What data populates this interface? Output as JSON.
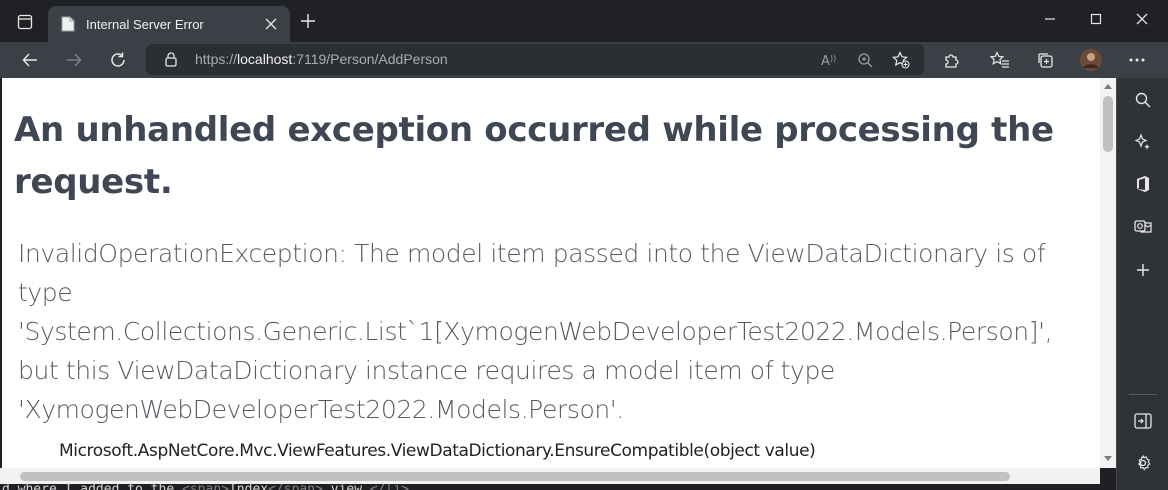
{
  "browser": {
    "tab_title": "Internal Server Error",
    "url_prefix": "https://",
    "url_host": "localhost",
    "url_rest": ":7119/Person/AddPerson",
    "colors": {
      "chrome": "#202124",
      "toolbar": "#3b3f46",
      "heading": "#3e4753"
    },
    "icons": {
      "tab_actions": "tab-actions-icon",
      "favicon": "page-icon",
      "tab_close": "close-icon",
      "new_tab": "plus-icon",
      "minimize": "minimize-icon",
      "maximize": "maximize-icon",
      "close_window": "close-icon",
      "back": "back-arrow-icon",
      "forward": "forward-arrow-icon",
      "refresh": "refresh-icon",
      "lock": "lock-icon",
      "read_aloud": "read-aloud-icon",
      "zoom": "zoom-icon",
      "add_favorite": "star-plus-icon",
      "extensions": "puzzle-icon",
      "favorites": "favorites-icon",
      "collections": "collections-icon",
      "profile": "avatar",
      "more": "more-icon"
    }
  },
  "page": {
    "heading": "An unhandled exception occurred while processing the request.",
    "message": "InvalidOperationException: The model item passed into the ViewDataDictionary is of type 'System.Collections.Generic.List`1[XymogenWebDeveloperTest2022.Models.Person]', but this ViewDataDictionary instance requires a model item of type 'XymogenWebDeveloperTest2022.Models.Person'.",
    "stack_line": "Microsoft.AspNetCore.Mvc.ViewFeatures.ViewDataDictionary.EnsureCompatible(object value)"
  },
  "sidebar": {
    "icons": [
      "search-icon",
      "sparkle-icon",
      "office-icon",
      "outlook-icon",
      "plus-icon",
      "split-screen-icon",
      "gear-icon"
    ]
  },
  "underlying_window": {
    "text_a": "d where I added to the ",
    "tag_open": "<span>",
    "tag_text": "Index",
    "tag_close": "</span>",
    "text_b": " view.",
    "tag_end": "</li>"
  }
}
